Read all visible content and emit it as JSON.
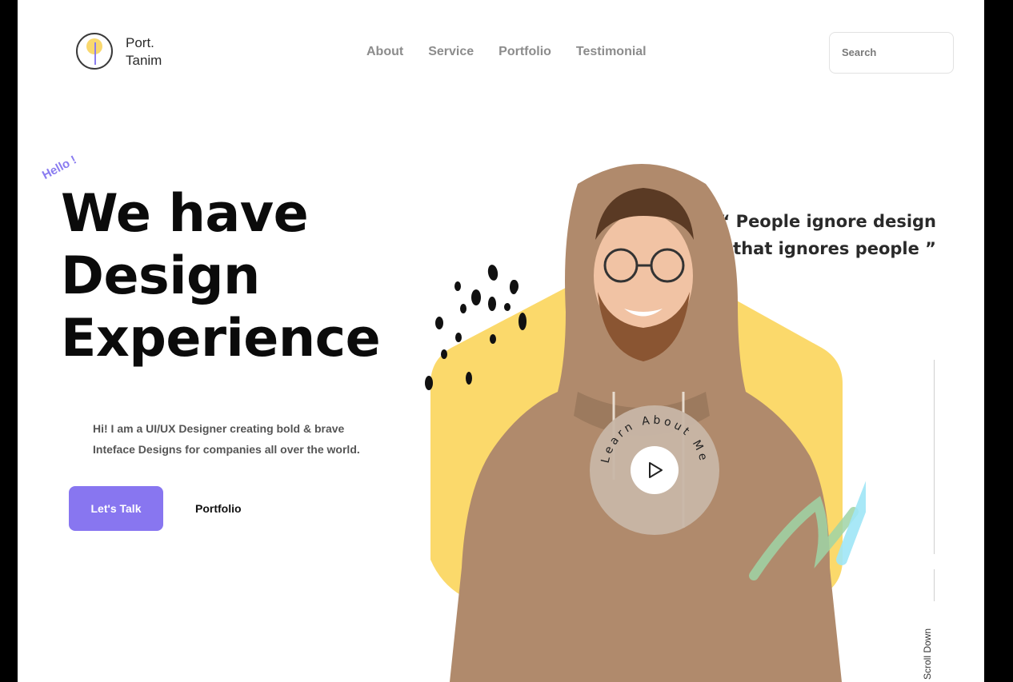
{
  "brand": {
    "line1": "Port.",
    "line2": "Tanim"
  },
  "nav": {
    "items": [
      "About",
      "Service",
      "Portfolio",
      "Testimonial"
    ]
  },
  "search": {
    "placeholder": "Search"
  },
  "hero": {
    "greeting": "Hello !",
    "headline": [
      "We have",
      "Design",
      "Experience"
    ],
    "intro": "Hi! I am a UI/UX Designer creating bold & brave Inteface Designs for companies all over the world.",
    "cta_primary": "Let's Talk",
    "cta_secondary": "Portfolio"
  },
  "quote": {
    "line1": "“ People ignore design",
    "line2": "that ignores people ”"
  },
  "learn_badge": {
    "label": "Learn About Me"
  },
  "scroll": {
    "label": "Scroll Down"
  },
  "colors": {
    "accent": "#8876f0",
    "hexagon": "#fbd96b",
    "hoodie": "#b08a6c",
    "scribble_blue": "#9fe6f6",
    "scribble_green": "#9fd4a6"
  },
  "icons": [
    "logo-mark-icon",
    "play-icon"
  ]
}
